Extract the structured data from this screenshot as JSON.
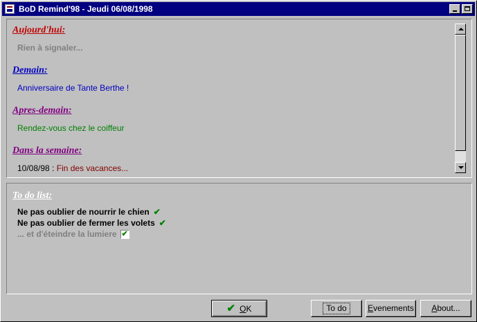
{
  "window": {
    "title": "BoD Remind'98 - Jeudi 06/08/1998",
    "minimize_glyph": "_",
    "maximize_glyph": "□"
  },
  "colors": {
    "titlebar": "#000080",
    "today": "#c00000",
    "tomorrow": "#0000c0",
    "after_tomorrow": "#800080",
    "week": "#800080"
  },
  "events": {
    "today": {
      "heading": "Aujourd'hui:",
      "text": "Rien à signaler..."
    },
    "tomorrow": {
      "heading": "Demain:",
      "text": "Anniversaire de Tante Berthe !"
    },
    "after_tomorrow": {
      "heading": "Apres-demain:",
      "text": "Rendez-vous chez le coiffeur"
    },
    "week": {
      "heading": "Dans la semaine:",
      "date": "10/08/98 :",
      "text": "Fin des vacances..."
    }
  },
  "todo": {
    "heading": "To do list:",
    "items": [
      {
        "text": "Ne pas oublier de nourrir le chien",
        "done": true
      },
      {
        "text": "Ne pas oublier de fermer les volets",
        "done": true
      },
      {
        "text": "... et d'éteindre la lumiere",
        "done": true
      }
    ]
  },
  "buttons": {
    "ok_mnemonic": "O",
    "ok_rest": "K",
    "todo": "To do",
    "events_mnemonic": "E",
    "events_rest": "venements",
    "about_mnemonic": "A",
    "about_rest": "bout..."
  },
  "icons": {
    "ok": "green-check-icon",
    "scroll_up": "arrow-up-icon",
    "scroll_down": "arrow-down-icon"
  }
}
